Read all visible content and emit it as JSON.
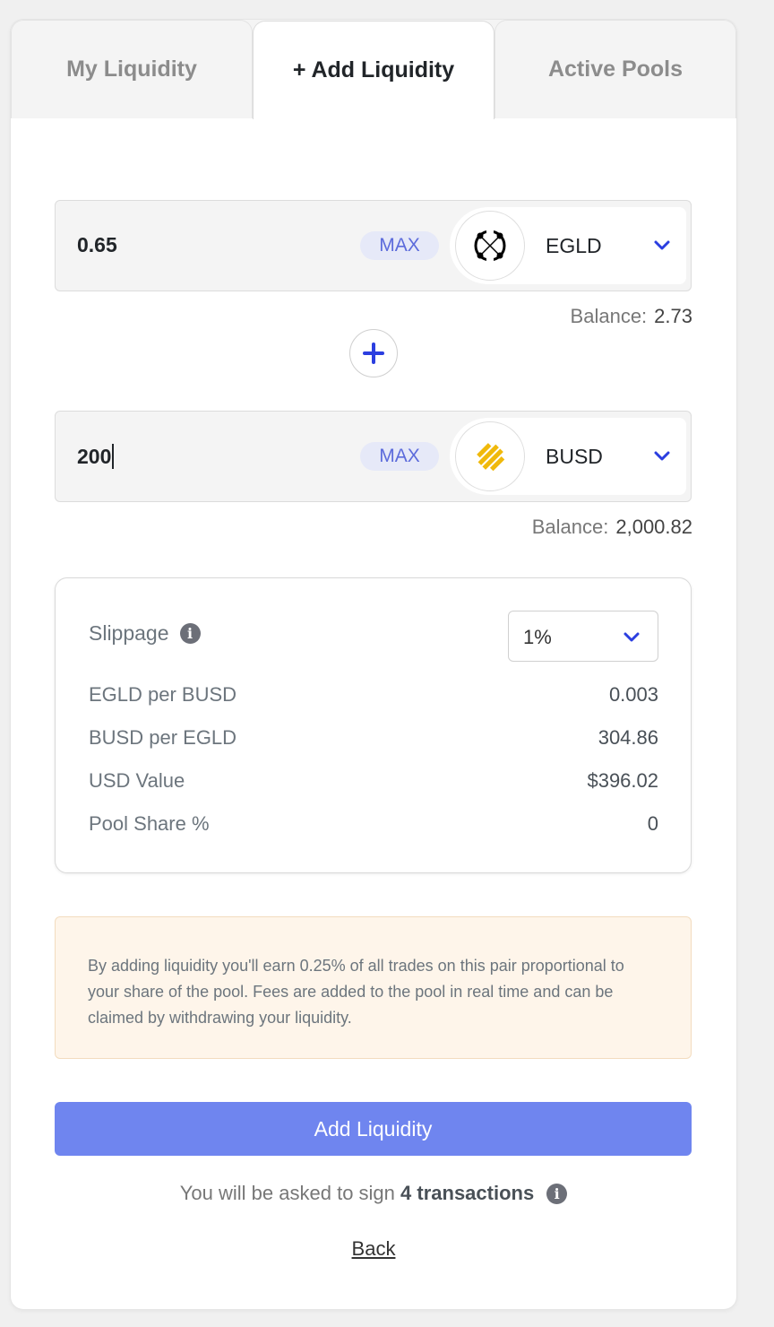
{
  "tabs": [
    {
      "label": "My Liquidity",
      "active": false
    },
    {
      "label": "+ Add Liquidity",
      "active": true
    },
    {
      "label": "Active Pools",
      "active": false
    }
  ],
  "token_a": {
    "amount": "0.65",
    "max_label": "MAX",
    "symbol": "EGLD",
    "icon": "egld-logo-icon",
    "balance_label": "Balance:",
    "balance_value": "2.73"
  },
  "token_b": {
    "amount": "200",
    "max_label": "MAX",
    "symbol": "BUSD",
    "icon": "busd-logo-icon",
    "balance_label": "Balance:",
    "balance_value": "2,000.82"
  },
  "details": {
    "slippage_label": "Slippage",
    "slippage_value": "1%",
    "rows": [
      {
        "label": "EGLD per BUSD",
        "value": "0.003"
      },
      {
        "label": "BUSD per EGLD",
        "value": "304.86"
      },
      {
        "label": "USD Value",
        "value": "$396.02"
      },
      {
        "label": "Pool Share %",
        "value": "0"
      }
    ]
  },
  "notice": "By adding liquidity you'll earn 0.25% of all trades on this pair proportional to your share of the pool. Fees are added to the pool in real time and can be claimed by withdrawing your liquidity.",
  "submit_label": "Add Liquidity",
  "sign_note": {
    "prefix": "You will be asked to sign",
    "count": "4 transactions"
  },
  "back_label": "Back",
  "colors": {
    "accent": "#6f85ef",
    "link_blue": "#2b3ee0",
    "busd": "#f0b90b",
    "notice_bg": "#fef5ea"
  }
}
